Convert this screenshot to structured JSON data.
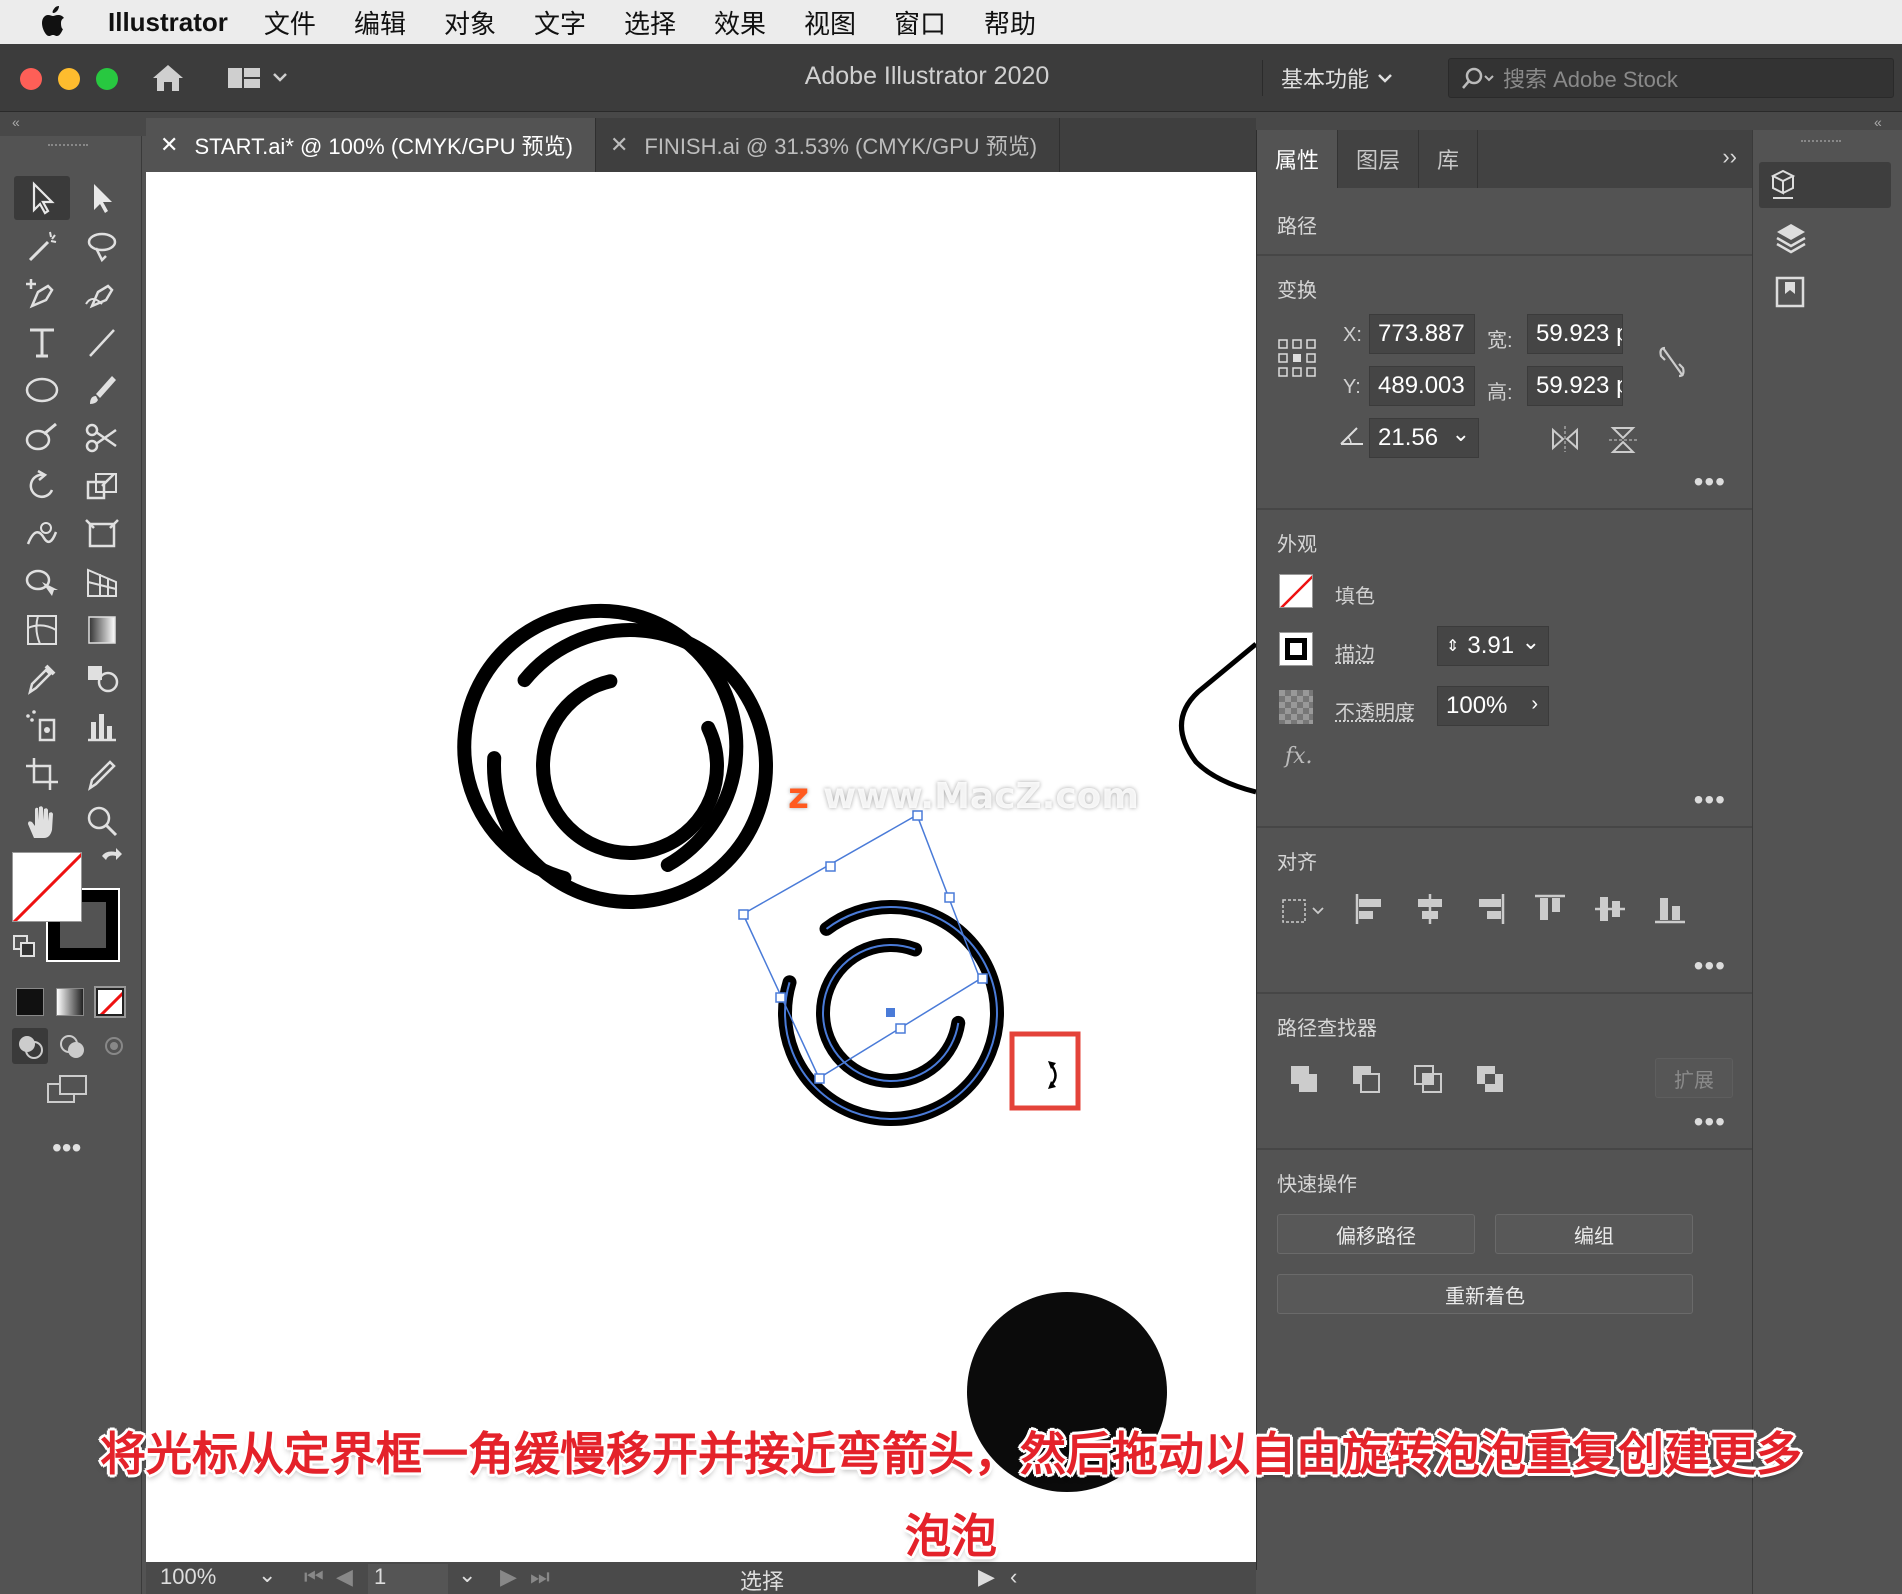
{
  "menubar": {
    "app": "Illustrator",
    "items": [
      "文件",
      "编辑",
      "对象",
      "文字",
      "选择",
      "效果",
      "视图",
      "窗口",
      "帮助"
    ]
  },
  "titlebar": {
    "title": "Adobe Illustrator 2020",
    "workspace": "基本功能",
    "search_placeholder": "搜索 Adobe Stock"
  },
  "tabs": [
    {
      "label": "START.ai* @ 100% (CMYK/GPU 预览)",
      "active": true
    },
    {
      "label": "FINISH.ai @ 31.53% (CMYK/GPU 预览)",
      "active": false
    }
  ],
  "panel": {
    "tabs": [
      "属性",
      "图层",
      "库"
    ],
    "selection_type": "路径",
    "transform": {
      "title": "变换",
      "x_label": "X:",
      "x": "773.887",
      "y_label": "Y:",
      "y": "489.003",
      "w_label": "宽:",
      "w": "59.923 p",
      "h_label": "高:",
      "h": "59.923 p",
      "angle": "21.56"
    },
    "appearance": {
      "title": "外观",
      "fill_label": "填色",
      "stroke_label": "描边",
      "stroke_value": "3.91",
      "opacity_label": "不透明度",
      "opacity_value": "100%",
      "fx": "fx."
    },
    "align": {
      "title": "对齐"
    },
    "pathfinder": {
      "title": "路径查找器",
      "expand": "扩展"
    },
    "quick_actions": {
      "title": "快速操作",
      "offset_path": "偏移路径",
      "group": "编组",
      "recolor": "重新着色"
    }
  },
  "statusbar": {
    "zoom": "100%",
    "artboard": "1",
    "tool_name": "选择"
  },
  "watermark": "www.MacZ.com",
  "caption": {
    "line1": "将光标从定界框一角缓慢移开并接近弯箭头，然后拖动以自由旋转泡泡重复创建更多",
    "line2": "泡泡"
  },
  "colors": {
    "accent_red": "#e4222a",
    "selection_blue": "#4a7bd8",
    "ui_dark": "#535353"
  }
}
